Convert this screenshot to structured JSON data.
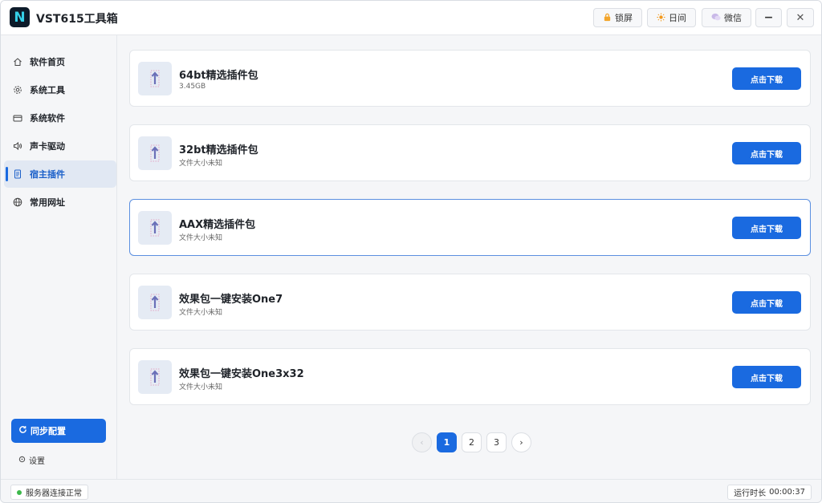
{
  "app": {
    "logo_letter": "N",
    "title": "VST615工具箱"
  },
  "titlebar": {
    "lock_label": "锁屏",
    "day_label": "日间",
    "wechat_label": "微信",
    "minimize_glyph": "−",
    "close_glyph": "✕"
  },
  "sidebar": {
    "items": [
      {
        "label": "软件首页",
        "icon": "home-icon"
      },
      {
        "label": "系统工具",
        "icon": "gear-icon"
      },
      {
        "label": "系统软件",
        "icon": "wallet-icon"
      },
      {
        "label": "声卡驱动",
        "icon": "speaker-icon"
      },
      {
        "label": "宿主插件",
        "icon": "document-icon",
        "active": true
      },
      {
        "label": "常用网址",
        "icon": "globe-icon"
      }
    ],
    "sync_label": "同步配置",
    "settings_label": "设置"
  },
  "cards": [
    {
      "title": "64bt精选插件包",
      "size": "3.45GB",
      "button": "点击下载"
    },
    {
      "title": "32bt精选插件包",
      "size": "文件大小未知",
      "button": "点击下载"
    },
    {
      "title": "AAX精选插件包",
      "size": "文件大小未知",
      "button": "点击下载",
      "selected": true
    },
    {
      "title": "效果包一键安装One7",
      "size": "文件大小未知",
      "button": "点击下载"
    },
    {
      "title": "效果包一键安装One3x32",
      "size": "文件大小未知",
      "button": "点击下载"
    }
  ],
  "pagination": {
    "prev": "‹",
    "pages": [
      "1",
      "2",
      "3"
    ],
    "current": "1",
    "next": "›"
  },
  "status": {
    "server_text": "服务器连接正常",
    "runtime_label": "运行时长",
    "runtime_value": "00:00:37"
  },
  "colors": {
    "accent": "#1a6ae0",
    "status_ok": "#3cb84a",
    "card_selected_border": "#5b8fe0"
  }
}
